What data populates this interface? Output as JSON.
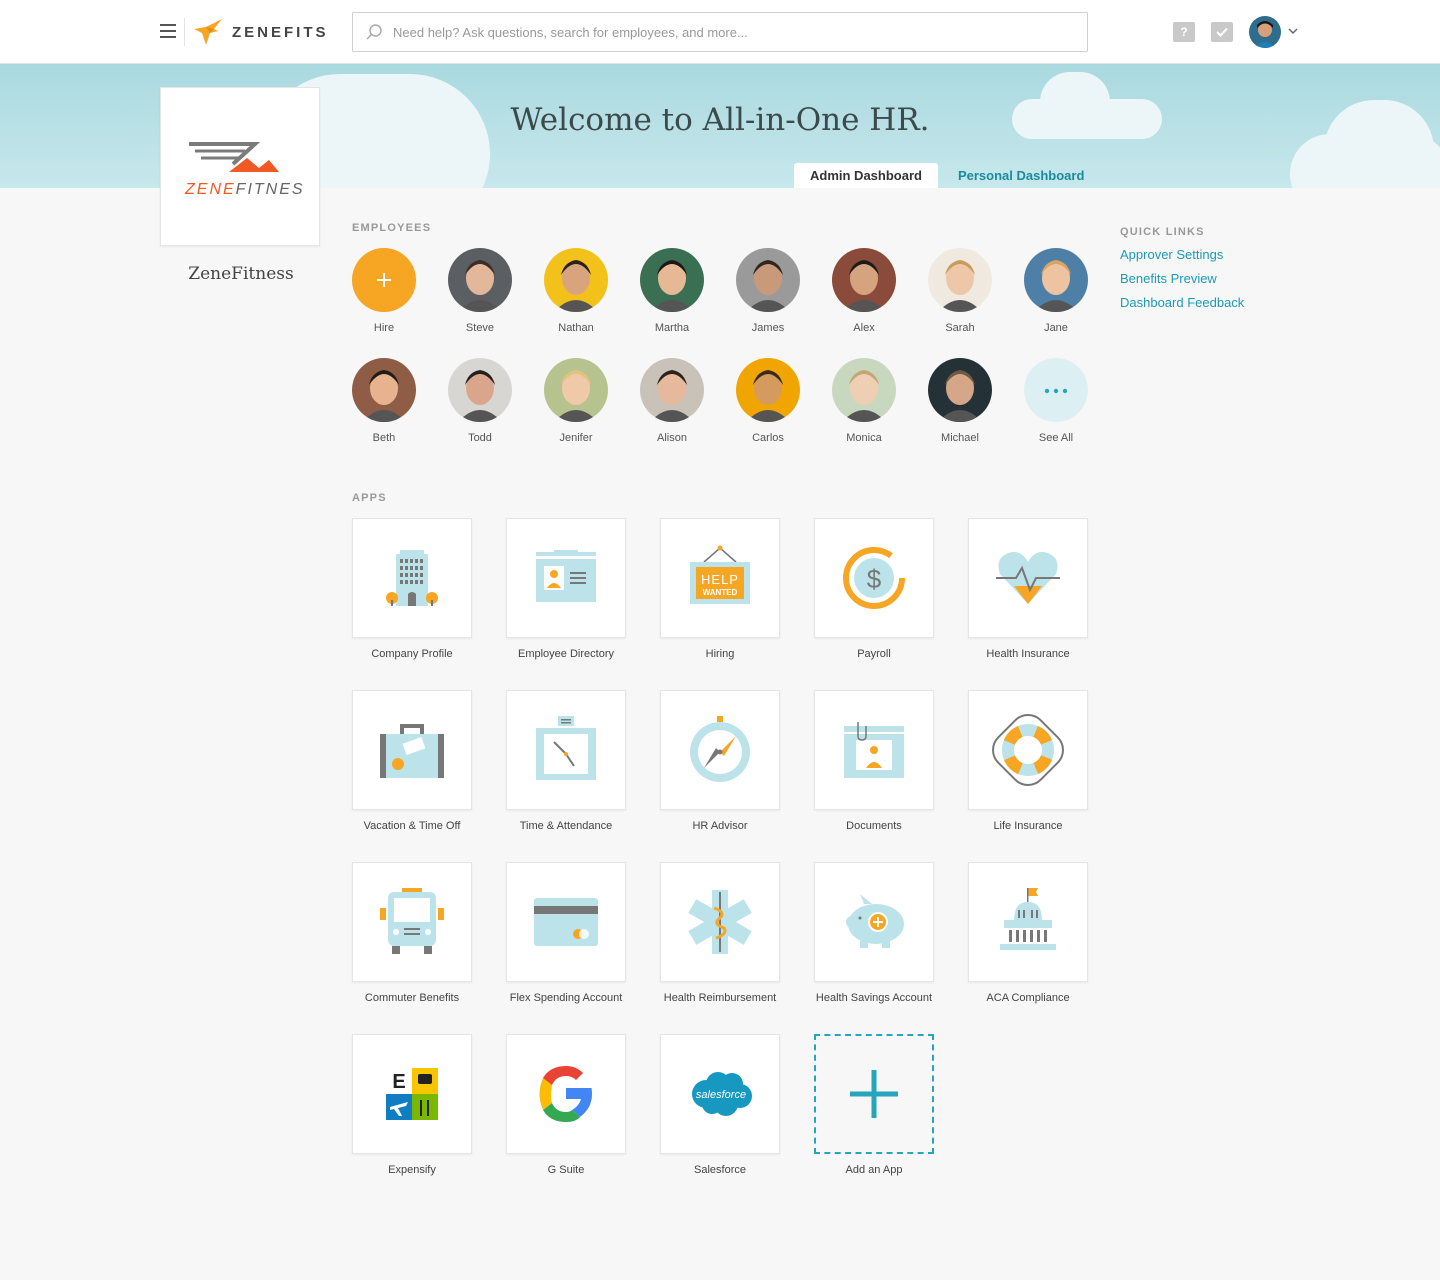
{
  "header": {
    "brand": "ZENEFITS",
    "search_placeholder": "Need help? Ask questions, search for employees, and more...",
    "help_label": "?"
  },
  "banner": {
    "welcome": "Welcome to All-in-One HR.",
    "tabs": [
      {
        "label": "Admin Dashboard",
        "active": true
      },
      {
        "label": "Personal Dashboard",
        "active": false
      }
    ]
  },
  "company": {
    "logo_text_orange": "ZENE",
    "logo_text_gray": "FITNESS",
    "name": "ZeneFitness"
  },
  "employees": {
    "title": "EMPLOYEES",
    "hire_label": "Hire",
    "see_all_label": "See All",
    "people": [
      {
        "name": "Steve",
        "bg": "#5b5f63",
        "skin": "#e3b79a",
        "hair": "#3a2f28"
      },
      {
        "name": "Nathan",
        "bg": "#f2c21b",
        "skin": "#d8a47e",
        "hair": "#2a211c"
      },
      {
        "name": "Martha",
        "bg": "#3b6f54",
        "skin": "#e6b894",
        "hair": "#1d1816"
      },
      {
        "name": "James",
        "bg": "#9a9a9a",
        "skin": "#c99a7a",
        "hair": "#2d2622"
      },
      {
        "name": "Alex",
        "bg": "#8a4b3b",
        "skin": "#d6a37f",
        "hair": "#1a1a1a"
      },
      {
        "name": "Sarah",
        "bg": "#efe9e0",
        "skin": "#edc7a8",
        "hair": "#c89b5a"
      },
      {
        "name": "Jane",
        "bg": "#4e7fa6",
        "skin": "#eec3a1",
        "hair": "#d9a662"
      },
      {
        "name": "Beth",
        "bg": "#8f5d45",
        "skin": "#e7b38f",
        "hair": "#231b18"
      },
      {
        "name": "Todd",
        "bg": "#d8d6d2",
        "skin": "#d9a68b",
        "hair": "#222"
      },
      {
        "name": "Jenifer",
        "bg": "#b6c38e",
        "skin": "#f0c9a8",
        "hair": "#e2c27e"
      },
      {
        "name": "Alison",
        "bg": "#c9c2b8",
        "skin": "#e6b89c",
        "hair": "#2c211d"
      },
      {
        "name": "Carlos",
        "bg": "#f0a500",
        "skin": "#d49a5e",
        "hair": "#3a2a1a"
      },
      {
        "name": "Monica",
        "bg": "#c8d8bf",
        "skin": "#efcfb4",
        "hair": "#c2a775"
      },
      {
        "name": "Michael",
        "bg": "#243238",
        "skin": "#d6a688",
        "hair": "#6b5a43"
      }
    ]
  },
  "apps": {
    "title": "APPS",
    "items": [
      {
        "label": "Company Profile",
        "icon": "building-icon"
      },
      {
        "label": "Employee Directory",
        "icon": "id-card-icon"
      },
      {
        "label": "Hiring",
        "icon": "help-wanted-sign-icon",
        "sign_top": "HELP",
        "sign_bottom": "WANTED"
      },
      {
        "label": "Payroll",
        "icon": "dollar-coin-icon",
        "symbol": "$"
      },
      {
        "label": "Health Insurance",
        "icon": "heart-pulse-icon"
      },
      {
        "label": "Vacation & Time Off",
        "icon": "suitcase-icon"
      },
      {
        "label": "Time & Attendance",
        "icon": "time-clock-icon"
      },
      {
        "label": "HR Advisor",
        "icon": "compass-icon"
      },
      {
        "label": "Documents",
        "icon": "folder-icon"
      },
      {
        "label": "Life Insurance",
        "icon": "life-ring-icon"
      },
      {
        "label": "Commuter Benefits",
        "icon": "bus-icon"
      },
      {
        "label": "Flex Spending Account",
        "icon": "credit-card-icon"
      },
      {
        "label": "Health Reimbursement",
        "icon": "medical-star-icon"
      },
      {
        "label": "Health Savings Account",
        "icon": "piggy-bank-icon"
      },
      {
        "label": "ACA Compliance",
        "icon": "capitol-building-icon"
      },
      {
        "label": "Expensify",
        "icon": "expensify-icon",
        "letter": "E"
      },
      {
        "label": "G Suite",
        "icon": "google-icon"
      },
      {
        "label": "Salesforce",
        "icon": "salesforce-icon",
        "brand": "salesforce"
      },
      {
        "label": "Add an App",
        "icon": "plus-icon"
      }
    ]
  },
  "quick_links": {
    "title": "QUICK LINKS",
    "items": [
      "Approver Settings",
      "Benefits Preview",
      "Dashboard Feedback"
    ]
  },
  "colors": {
    "accent": "#1b9bb5",
    "orange": "#f6a623",
    "icon_blue": "#bde3ea"
  }
}
